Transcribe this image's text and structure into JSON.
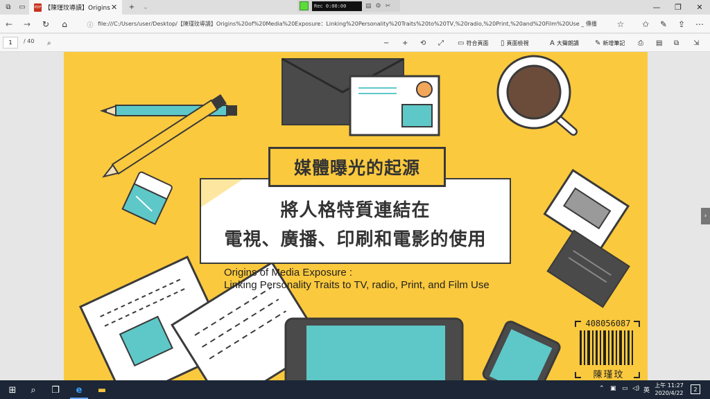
{
  "browser": {
    "tab_title": "【陳瑾玟導讀】Origins",
    "tab_badge": "PDF",
    "new_tab": "+",
    "tab_close": "✕",
    "url": "file:///C:/Users/user/Desktop/【陳瑾玟導讀】Origins%20of%20Media%20Exposure：Linking%20Personality%20Traits%20to%20TV,%20radio,%20Print,%20and%20Film%20Use _ 傳播",
    "recorder_text": "Rec 0:00:00"
  },
  "pdf_toolbar": {
    "page_current": "1",
    "page_total": "/ 40",
    "fit_page": "符合頁面",
    "page_view": "頁面檢視",
    "read_aloud": "大聲朗讀",
    "add_notes": "新增筆記"
  },
  "slide": {
    "title": "媒體曝光的起源",
    "subtitle_line1": "將人格特質連結在",
    "subtitle_line2": "電視、廣播、印刷和電影的使用",
    "english_line1": "Origins of Media Exposure :",
    "english_line2": "Linking Personality Traits to TV, radio, Print, and Film Use",
    "student_id": "408056087",
    "student_name": "陳瑾玟"
  },
  "taskbar": {
    "time": "上午 11:27",
    "date": "2020/4/22",
    "notifications": "2"
  },
  "colors": {
    "slide_bg": "#fbc93d",
    "teal": "#5ec8c8",
    "dark": "#3a3a3a",
    "taskbar": "#1c2636"
  }
}
